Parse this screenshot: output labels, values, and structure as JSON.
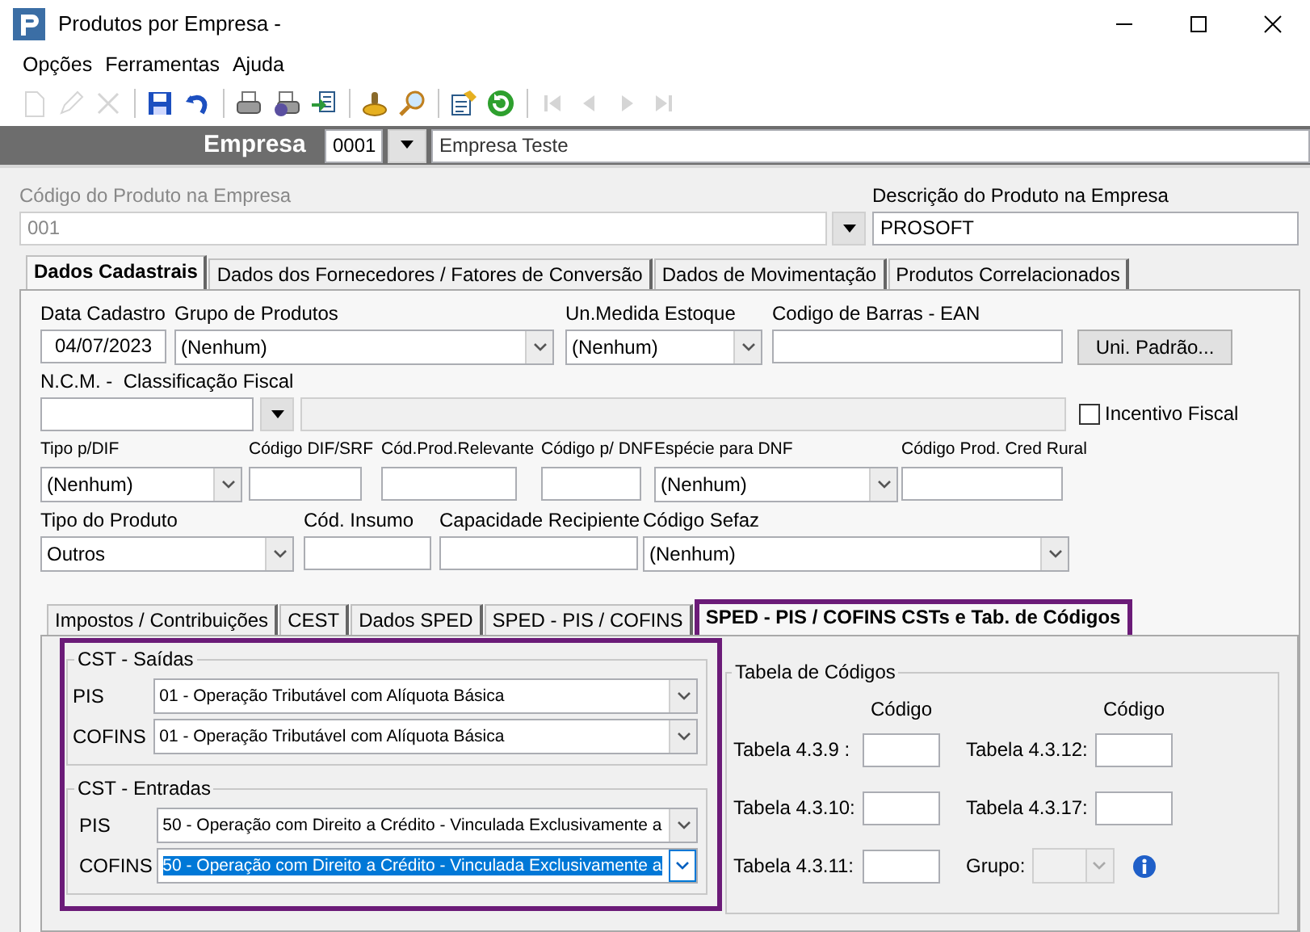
{
  "window": {
    "title": "Produtos por Empresa -"
  },
  "menu": [
    "Opções",
    "Ferramentas",
    "Ajuda"
  ],
  "toolbar": [
    {
      "kind": "new",
      "disabled": true
    },
    {
      "kind": "edit",
      "disabled": true
    },
    {
      "kind": "delete",
      "disabled": true
    },
    {
      "kind": "sep"
    },
    {
      "kind": "save",
      "disabled": false
    },
    {
      "kind": "undo",
      "disabled": false
    },
    {
      "kind": "sep"
    },
    {
      "kind": "print",
      "disabled": false
    },
    {
      "kind": "print_setup",
      "disabled": false
    },
    {
      "kind": "export",
      "disabled": false
    },
    {
      "kind": "sep"
    },
    {
      "kind": "stamp",
      "disabled": false
    },
    {
      "kind": "search",
      "disabled": false
    },
    {
      "kind": "sep"
    },
    {
      "kind": "properties",
      "disabled": false
    },
    {
      "kind": "refresh",
      "disabled": false
    },
    {
      "kind": "sep"
    },
    {
      "kind": "first",
      "disabled": true
    },
    {
      "kind": "prev",
      "disabled": true
    },
    {
      "kind": "next",
      "disabled": true
    },
    {
      "kind": "last",
      "disabled": true
    }
  ],
  "empresa": {
    "label": "Empresa",
    "code": "0001",
    "name": "Empresa Teste"
  },
  "produto": {
    "code_label": "Código do Produto na Empresa",
    "code": "001",
    "code_disabled": true,
    "desc_label": "Descrição do Produto na Empresa",
    "desc": "PROSOFT"
  },
  "tabs": [
    {
      "label": "Dados Cadastrais",
      "selected": true
    },
    {
      "label": "Dados dos Fornecedores / Fatores de Conversão",
      "selected": false
    },
    {
      "label": "Dados de Movimentação",
      "selected": false
    },
    {
      "label": "Produtos Correlacionados",
      "selected": false
    }
  ],
  "form_rows": [
    [
      {
        "kind": "date",
        "label": "Data Cadastro",
        "value": "04/07/2023"
      },
      {
        "kind": "combo",
        "label": "Grupo de Produtos",
        "value": "(Nenhum)"
      },
      {
        "kind": "combo",
        "label": "Un.Medida Estoque",
        "value": "(Nenhum)"
      },
      {
        "kind": "field",
        "label": "Codigo de Barras - EAN"
      },
      {
        "kind": "button",
        "label": "Uni. Padrão..."
      }
    ],
    [
      {
        "kind": "combo",
        "label": "Tipo p/DIF",
        "value": "(Nenhum)"
      },
      {
        "kind": "field",
        "label": "Código DIF/SRF"
      },
      {
        "kind": "field",
        "label": "Cód.Prod.Relevante"
      },
      {
        "kind": "field",
        "label": "Código p/ DNF"
      },
      {
        "kind": "combo",
        "label": "Espécie para DNF",
        "value": "(Nenhum)"
      },
      {
        "kind": "field",
        "label": "Código Prod. Cred Rural"
      }
    ],
    [
      {
        "kind": "combo",
        "label": "Tipo do Produto",
        "value": "Outros"
      },
      {
        "kind": "field",
        "label": "Cód. Insumo"
      },
      {
        "kind": "field",
        "label": "Capacidade Recipiente"
      },
      {
        "kind": "combo",
        "label": "Código Sefaz",
        "value": "(Nenhum)"
      }
    ]
  ],
  "ncm": {
    "label": "N.C.M. -  Classificação Fiscal",
    "desc_disabled": true
  },
  "incentivo_fiscal": {
    "label": "Incentivo Fiscal",
    "checked": false
  },
  "inner_tabs": [
    {
      "label": "Impostos / Contribuições",
      "selected": false,
      "outlined": false
    },
    {
      "label": "CEST",
      "selected": false,
      "outlined": false
    },
    {
      "label": "Dados SPED",
      "selected": false,
      "outlined": false
    },
    {
      "label": "SPED - PIS / COFINS",
      "selected": false,
      "outlined": false
    },
    {
      "label": "SPED - PIS / COFINS CSTs e Tab. de Códigos",
      "selected": true,
      "outlined": true
    }
  ],
  "cst_outlined": true,
  "cst_groups": [
    {
      "title": "CST - Saídas",
      "rows": [
        {
          "label": "PIS",
          "value": "01 - Operação Tributável com Alíquota Básica",
          "focused": false
        },
        {
          "label": "COFINS",
          "value": "01 - Operação Tributável com Alíquota Básica",
          "focused": false
        }
      ]
    },
    {
      "title": "CST - Entradas",
      "rows": [
        {
          "label": "PIS",
          "value": "50 - Operação com Direito a Crédito - Vinculada Exclusivamente a",
          "focused": false
        },
        {
          "label": "COFINS",
          "value": "50 - Operação com Direito a Crédito - Vinculada Exclusivamente a",
          "focused": true
        }
      ]
    }
  ],
  "code_table": {
    "title": "Tabela de Códigos",
    "column_headers": [
      "Código",
      "Código"
    ],
    "rows": [
      [
        {
          "kind": "field",
          "label": "Tabela 4.3.9 :"
        },
        {
          "kind": "field",
          "label": "Tabela 4.3.12:"
        }
      ],
      [
        {
          "kind": "field",
          "label": "Tabela 4.3.10:"
        },
        {
          "kind": "field",
          "label": "Tabela 4.3.17:"
        }
      ],
      [
        {
          "kind": "field",
          "label": "Tabela 4.3.11:"
        },
        {
          "kind": "combo",
          "label": "Grupo:",
          "disabled": true,
          "info": true
        }
      ]
    ]
  }
}
